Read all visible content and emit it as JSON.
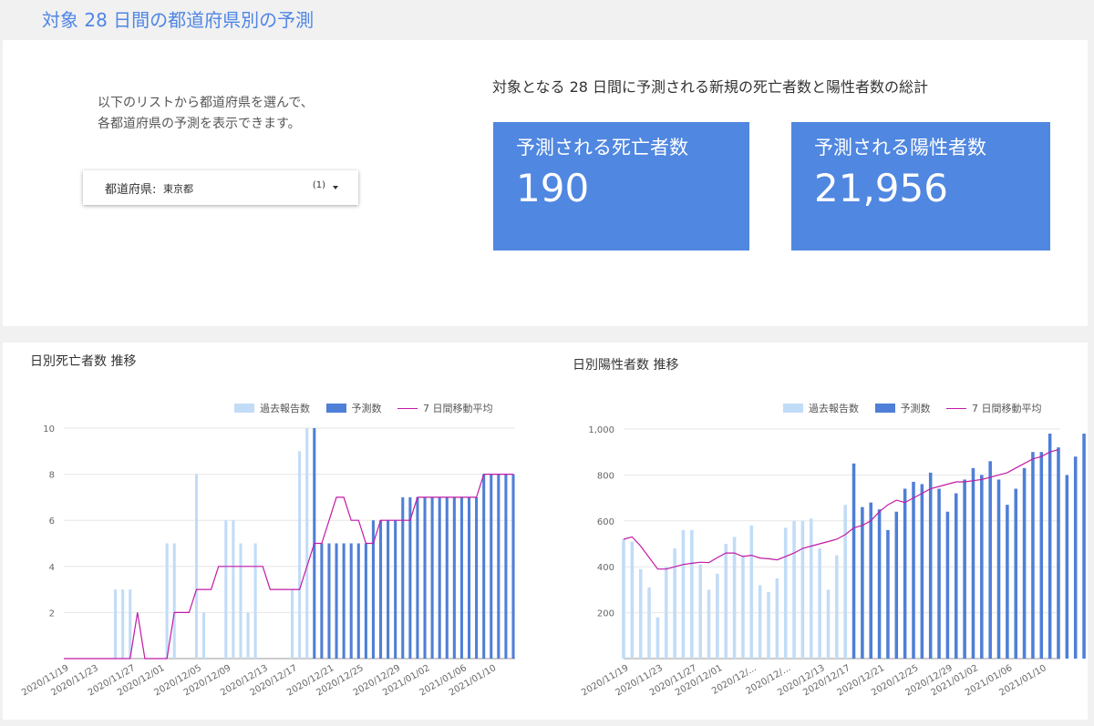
{
  "page_title": "対象 28 日間の都道府県別の予測",
  "intro": {
    "line1": "以下のリストから都道府県を選んで、",
    "line2": "各都道府県の予測を表示できます。"
  },
  "dropdown": {
    "label": "都道府県:",
    "value": "東京都",
    "count": "(1)"
  },
  "summary": {
    "heading": "対象となる 28 日間に予測される新規の死亡者数と陽性者数の総計",
    "deaths_label": "予測される死亡者数",
    "deaths_value": "190",
    "positives_label": "予測される陽性者数",
    "positives_value": "21,956"
  },
  "colors": {
    "past": "#c2dcf7",
    "forecast": "#4f7fd6",
    "avg": "#c21aa5",
    "kpi": "#5087e0",
    "title": "#4f86e5"
  },
  "chart_data": [
    {
      "type": "bar",
      "title": "日別死亡者数 推移",
      "legend": [
        "過去報告数",
        "予測数",
        "7 日間移動平均"
      ],
      "legend_position": "top-right",
      "x_tick_labels": [
        "2020/11/19",
        "2020/11/23",
        "2020/11/27",
        "2020/12/01",
        "2020/12/05",
        "2020/12/09",
        "2020/12/13",
        "2020/12/17",
        "2020/12/21",
        "2020/12/25",
        "2020/12/29",
        "2021/01/02",
        "2021/01/06",
        "2021/01/10"
      ],
      "y_ticks": [
        "2",
        "4",
        "6",
        "8",
        "10"
      ],
      "ylim": [
        0,
        10
      ],
      "grid": true,
      "start_date": "2020-11-19",
      "series": [
        {
          "name": "過去報告数",
          "start_index": 0,
          "values": [
            0,
            0,
            0,
            0,
            0,
            0,
            0,
            3,
            3,
            3,
            0,
            0,
            0,
            0,
            5,
            5,
            0,
            0,
            8,
            2,
            0,
            0,
            6,
            6,
            5,
            2,
            5,
            0,
            0,
            0,
            0,
            3,
            9,
            10
          ]
        },
        {
          "name": "予測数",
          "start_index": 34,
          "values": [
            10,
            5,
            5,
            5,
            5,
            5,
            5,
            5,
            6,
            6,
            6,
            6,
            7,
            7,
            7,
            7,
            7,
            7,
            7,
            7,
            7,
            7,
            7,
            8,
            8,
            8,
            8,
            8
          ]
        },
        {
          "name": "7 日間移動平均",
          "start_index": 0,
          "values": [
            0,
            0,
            0,
            0,
            0,
            0,
            0,
            0,
            0,
            0,
            2,
            0,
            0,
            0,
            0,
            2,
            2,
            2,
            3,
            3,
            3,
            4,
            4,
            4,
            4,
            4,
            4,
            4,
            3,
            3,
            3,
            3,
            3,
            4,
            5,
            5,
            6,
            7,
            7,
            6,
            6,
            5,
            5,
            6,
            6,
            6,
            6,
            6,
            7,
            7,
            7,
            7,
            7,
            7,
            7,
            7,
            7,
            8,
            8,
            8,
            8,
            8
          ]
        }
      ]
    },
    {
      "type": "bar",
      "title": "日別陽性者数 推移",
      "legend": [
        "過去報告数",
        "予測数",
        "7 日間移動平均"
      ],
      "legend_position": "top-right",
      "x_tick_labels": [
        "2020/11/19",
        "2020/11/23",
        "2020/11/27",
        "2020/12/01",
        "2020/12/...",
        "2020/12/...",
        "2020/12/13",
        "2020/12/17",
        "2020/12/21",
        "2020/12/25",
        "2020/12/29",
        "2021/01/02",
        "2021/01/06",
        "2021/01/10"
      ],
      "y_ticks": [
        "200",
        "400",
        "600",
        "800",
        "1,000"
      ],
      "ylim": [
        0,
        1000
      ],
      "grid": true,
      "start_date": "2020-11-19",
      "series": [
        {
          "name": "過去報告数",
          "start_index": 0,
          "values": [
            520,
            510,
            390,
            310,
            180,
            400,
            480,
            560,
            560,
            410,
            300,
            370,
            500,
            530,
            450,
            580,
            320,
            290,
            350,
            570,
            600,
            600,
            610,
            480,
            300,
            450,
            670
          ]
        },
        {
          "name": "予測数",
          "start_index": 27,
          "values": [
            850,
            660,
            680,
            650,
            560,
            640,
            740,
            770,
            760,
            810,
            740,
            640,
            720,
            780,
            830,
            800,
            860,
            780,
            670,
            740,
            830,
            900,
            900,
            980,
            920,
            800,
            880,
            980
          ]
        },
        {
          "name": "7 日間移動平均",
          "start_index": 0,
          "values": [
            520,
            530,
            490,
            440,
            390,
            390,
            400,
            410,
            415,
            420,
            418,
            440,
            460,
            460,
            445,
            450,
            438,
            435,
            430,
            445,
            460,
            480,
            490,
            500,
            510,
            520,
            540,
            570,
            580,
            600,
            640,
            670,
            690,
            680,
            700,
            720,
            740,
            750,
            760,
            770,
            770,
            775,
            780,
            790,
            800,
            810,
            830,
            850,
            870,
            880,
            900,
            910
          ]
        }
      ]
    }
  ]
}
